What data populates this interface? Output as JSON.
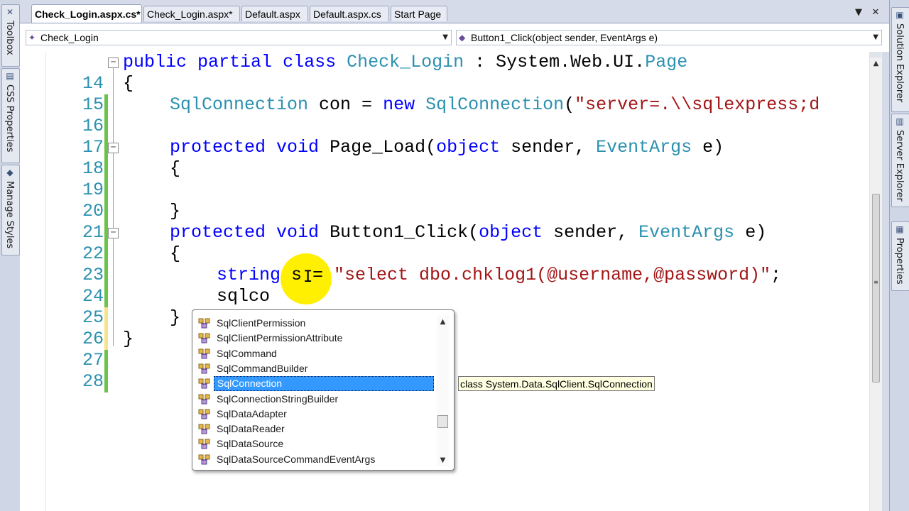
{
  "left_dock": {
    "tabs": [
      {
        "label": "Toolbox",
        "icon": "toolbox-icon"
      },
      {
        "label": "CSS Properties",
        "icon": "css-properties-icon"
      },
      {
        "label": "Manage Styles",
        "icon": "manage-styles-icon"
      }
    ]
  },
  "right_dock": {
    "tabs": [
      {
        "label": "Solution Explorer",
        "icon": "solution-explorer-icon"
      },
      {
        "label": "Server Explorer",
        "icon": "server-explorer-icon"
      },
      {
        "label": "Properties",
        "icon": "properties-icon"
      }
    ]
  },
  "tabs": [
    {
      "label": "Check_Login.aspx.cs*",
      "active": true
    },
    {
      "label": "Check_Login.aspx*",
      "active": false
    },
    {
      "label": "Default.aspx",
      "active": false
    },
    {
      "label": "Default.aspx.cs",
      "active": false
    },
    {
      "label": "Start Page",
      "active": false
    }
  ],
  "tab_strip": {
    "dropdown_icon": "chevron-down-icon",
    "close_icon": "close-icon"
  },
  "nav": {
    "class_combo": "Check_Login",
    "member_combo": "Button1_Click(object sender, EventArgs e)"
  },
  "code": {
    "line_numbers": [
      "14",
      "15",
      "16",
      "17",
      "18",
      "19",
      "20",
      "21",
      "22",
      "23",
      "24",
      "25",
      "26",
      "27",
      "28"
    ],
    "l14": {
      "kw1": "public",
      "kw2": "partial",
      "kw3": "class",
      "type": "Check_Login",
      "rest": " : System.Web.UI.",
      "type2": "Page"
    },
    "l15": {
      "text": "{"
    },
    "l16": {
      "type1": "SqlConnection",
      "mid": " con = ",
      "kw": "new",
      "type2": "SqlConnection",
      "paren": "(",
      "str": "\"server=.\\\\sqlexpress;d"
    },
    "l18": {
      "kw1": "protected",
      "kw2": "void",
      "name": " Page_Load(",
      "kw3": "object",
      "mid": " sender, ",
      "type": "EventArgs",
      "end": " e)"
    },
    "l19": {
      "text": "{"
    },
    "l21": {
      "text": "}"
    },
    "l22": {
      "kw1": "protected",
      "kw2": "void",
      "name": " Button1_Click(",
      "kw3": "object",
      "mid": " sender, ",
      "type": "EventArgs",
      "end": " e)"
    },
    "l23": {
      "text": "{"
    },
    "l24": {
      "kw": "string",
      "mid": " s = ",
      "str": "\"select dbo.chklog1(@username,@password)\"",
      "end": ";"
    },
    "l25": {
      "text": "sqlco"
    },
    "l26": {
      "text": "}"
    },
    "l27": {
      "text": "}"
    }
  },
  "completion": {
    "items": [
      "SqlClientPermission",
      "SqlClientPermissionAttribute",
      "SqlCommand",
      "SqlCommandBuilder",
      "SqlConnection",
      "SqlConnectionStringBuilder",
      "SqlDataAdapter",
      "SqlDataReader",
      "SqlDataSource",
      "SqlDataSourceCommandEventArgs"
    ],
    "selected_index": 4,
    "item_icon": "class-icon"
  },
  "tooltip": "class System.Data.SqlClient.SqlConnection",
  "colors": {
    "keyword": "#0000ff",
    "type": "#2b91af",
    "string": "#a31515",
    "line_number": "#2b91af",
    "selection": "#3399ff",
    "cursor_highlight": "#ffef00"
  }
}
